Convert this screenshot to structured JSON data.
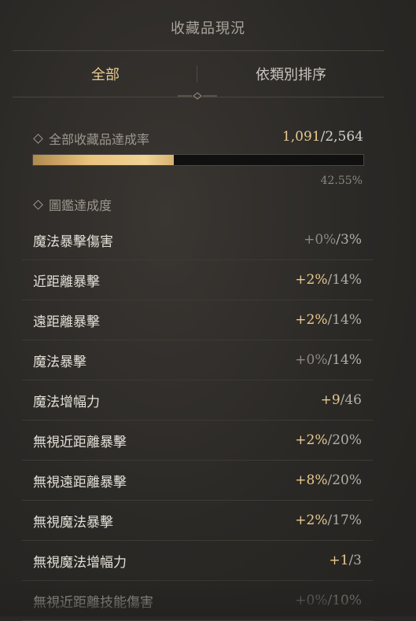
{
  "title": "收藏品現況",
  "tabs": [
    {
      "label": "全部",
      "active": true
    },
    {
      "label": "依類別排序",
      "active": false
    }
  ],
  "overall": {
    "label": "全部收藏品達成率",
    "current": "1,091",
    "total": "2,564",
    "percent_text": "42.55%",
    "progress": 0.4255
  },
  "codex": {
    "label": "圖鑑達成度"
  },
  "rows": [
    {
      "name": "魔法暴擊傷害",
      "bonus": "+0%",
      "max": "/3%",
      "active": false
    },
    {
      "name": "近距離暴擊",
      "bonus": "+2%",
      "max": "/14%",
      "active": true
    },
    {
      "name": "遠距離暴擊",
      "bonus": "+2%",
      "max": "/14%",
      "active": true
    },
    {
      "name": "魔法暴擊",
      "bonus": "+0%",
      "max": "/14%",
      "active": false
    },
    {
      "name": "魔法增幅力",
      "bonus": "+9",
      "max": "/46",
      "active": true
    },
    {
      "name": "無視近距離暴擊",
      "bonus": "+2%",
      "max": "/20%",
      "active": true
    },
    {
      "name": "無視遠距離暴擊",
      "bonus": "+8%",
      "max": "/20%",
      "active": true
    },
    {
      "name": "無視魔法暴擊",
      "bonus": "+2%",
      "max": "/17%",
      "active": true
    },
    {
      "name": "無視魔法增幅力",
      "bonus": "+1",
      "max": "/3",
      "active": true
    },
    {
      "name": "無視近距離技能傷害",
      "bonus": "+0%",
      "max": "/10%",
      "active": false
    }
  ],
  "colors": {
    "accent_gold": "#e8c98e",
    "inactive_value": "#8d8880"
  }
}
